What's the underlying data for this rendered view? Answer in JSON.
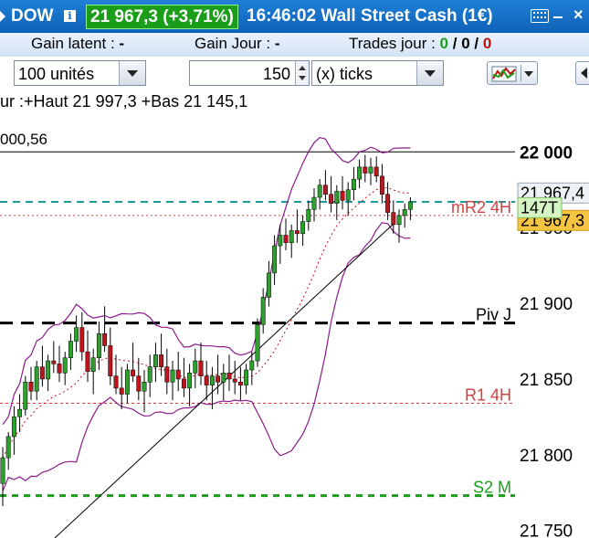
{
  "header": {
    "symbol": "DOW",
    "price_change": "21 967,3 (+3,71%)",
    "time_instrument": "16:46:02 Wall Street Cash (1€)",
    "close_label": "×"
  },
  "stats": {
    "gain_latent_label": "Gain latent :",
    "gain_latent_value": "-",
    "gain_jour_label": "Gain Jour :",
    "gain_jour_value": "-",
    "trades_label": "Trades jour :",
    "trades_win": "0",
    "trades_sep1": "/",
    "trades_mid": "0",
    "trades_sep2": "/",
    "trades_loss": "0"
  },
  "toolbar": {
    "units": "100 unités",
    "tick_count": "150",
    "tick_mode": "(x) ticks"
  },
  "chart": {
    "info_text": "ur :+Haut 21 997,3 +Bas 21 145,1",
    "price_tag": "000,56",
    "axis_labels": [
      "22 000",
      "21 950",
      "21 900",
      "21 850",
      "21 800",
      "21 750"
    ],
    "level_labels": {
      "mr2": "mR2 4H",
      "piv": "Piv J",
      "r1": "R1 4H",
      "s2": "S2 M"
    },
    "badges": {
      "last": "21 967,4",
      "ticks": "147T",
      "bid": "21 967,3"
    },
    "colors": {
      "candle_up": "#2ea02e",
      "candle_down": "#c0141c",
      "bollinger": "#8b1a8b",
      "mr2_line": "#1a9c9c",
      "piv_line": "#000000",
      "r1_line": "#d04040",
      "s2_line": "#1a9e1a"
    }
  },
  "chart_data": {
    "type": "candlestick",
    "candles": [
      [
        21781,
        21805,
        21766,
        21798
      ],
      [
        21798,
        21815,
        21790,
        21812
      ],
      [
        21812,
        21832,
        21800,
        21825
      ],
      [
        21825,
        21840,
        21815,
        21830
      ],
      [
        21830,
        21852,
        21826,
        21848
      ],
      [
        21848,
        21858,
        21836,
        21842
      ],
      [
        21842,
        21862,
        21836,
        21858
      ],
      [
        21858,
        21872,
        21845,
        21850
      ],
      [
        21850,
        21866,
        21842,
        21862
      ],
      [
        21862,
        21875,
        21854,
        21860
      ],
      [
        21860,
        21872,
        21848,
        21854
      ],
      [
        21854,
        21868,
        21846,
        21864
      ],
      [
        21864,
        21880,
        21856,
        21875
      ],
      [
        21875,
        21892,
        21868,
        21884
      ],
      [
        21884,
        21894,
        21862,
        21868
      ],
      [
        21868,
        21882,
        21848,
        21855
      ],
      [
        21855,
        21870,
        21840,
        21864
      ],
      [
        21864,
        21888,
        21856,
        21880
      ],
      [
        21880,
        21898,
        21868,
        21872
      ],
      [
        21872,
        21884,
        21846,
        21852
      ],
      [
        21852,
        21866,
        21840,
        21844
      ],
      [
        21844,
        21858,
        21830,
        21840
      ],
      [
        21840,
        21860,
        21834,
        21856
      ],
      [
        21856,
        21874,
        21848,
        21852
      ],
      [
        21852,
        21864,
        21836,
        21842
      ],
      [
        21842,
        21856,
        21828,
        21848
      ],
      [
        21848,
        21866,
        21838,
        21858
      ],
      [
        21858,
        21874,
        21848,
        21866
      ],
      [
        21866,
        21880,
        21852,
        21858
      ],
      [
        21858,
        21870,
        21840,
        21848
      ],
      [
        21848,
        21862,
        21836,
        21856
      ],
      [
        21856,
        21868,
        21842,
        21850
      ],
      [
        21850,
        21864,
        21838,
        21844
      ],
      [
        21844,
        21860,
        21832,
        21854
      ],
      [
        21854,
        21870,
        21844,
        21862
      ],
      [
        21862,
        21874,
        21846,
        21852
      ],
      [
        21852,
        21862,
        21836,
        21846
      ],
      [
        21846,
        21858,
        21830,
        21852
      ],
      [
        21852,
        21866,
        21840,
        21848
      ],
      [
        21848,
        21860,
        21836,
        21854
      ],
      [
        21854,
        21866,
        21842,
        21850
      ],
      [
        21850,
        21862,
        21840,
        21848
      ],
      [
        21848,
        21858,
        21836,
        21846
      ],
      [
        21846,
        21860,
        21840,
        21856
      ],
      [
        21856,
        21868,
        21846,
        21862
      ],
      [
        21862,
        21890,
        21858,
        21886
      ],
      [
        21886,
        21910,
        21880,
        21904
      ],
      [
        21904,
        21928,
        21898,
        21920
      ],
      [
        21920,
        21945,
        21912,
        21938
      ],
      [
        21938,
        21952,
        21926,
        21945
      ],
      [
        21945,
        21956,
        21935,
        21940
      ],
      [
        21940,
        21952,
        21930,
        21948
      ],
      [
        21948,
        21962,
        21940,
        21946
      ],
      [
        21946,
        21958,
        21938,
        21954
      ],
      [
        21954,
        21968,
        21948,
        21962
      ],
      [
        21962,
        21976,
        21954,
        21970
      ],
      [
        21970,
        21982,
        21962,
        21978
      ],
      [
        21978,
        21988,
        21968,
        21972
      ],
      [
        21972,
        21984,
        21960,
        21966
      ],
      [
        21966,
        21978,
        21955,
        21974
      ],
      [
        21974,
        21984,
        21962,
        21968
      ],
      [
        21968,
        21980,
        21958,
        21975
      ],
      [
        21975,
        21990,
        21968,
        21982
      ],
      [
        21982,
        21995,
        21976,
        21990
      ],
      [
        21990,
        21998,
        21980,
        21986
      ],
      [
        21986,
        21996,
        21978,
        21990
      ],
      [
        21990,
        21997,
        21980,
        21984
      ],
      [
        21984,
        21992,
        21966,
        21972
      ],
      [
        21972,
        21980,
        21955,
        21960
      ],
      [
        21960,
        21968,
        21946,
        21952
      ],
      [
        21952,
        21962,
        21940,
        21958
      ],
      [
        21958,
        21966,
        21950,
        21962
      ],
      [
        21962,
        21970,
        21955,
        21967
      ]
    ],
    "ylim": [
      21745,
      22040
    ],
    "levels": {
      "mr2": 21967,
      "piv": 21887,
      "r1": 21834,
      "s2": 21773
    },
    "hline_22000": 22000
  }
}
